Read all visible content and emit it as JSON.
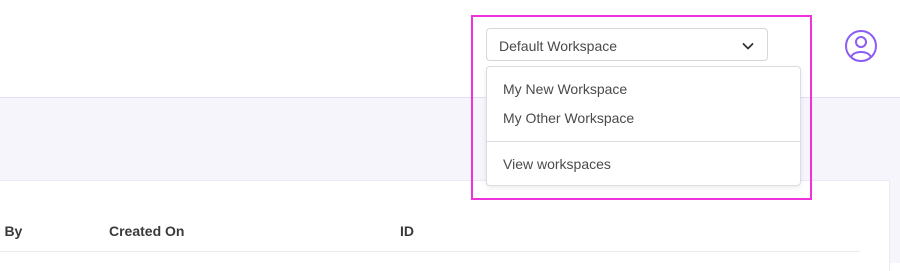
{
  "header": {
    "workspace_select": {
      "selected": "Default Workspace",
      "options": [
        "My New Workspace",
        "My Other Workspace"
      ],
      "footer_link": "View workspaces",
      "chevron_icon": "chevron-down-icon"
    },
    "avatar_icon": "user-circle-icon"
  },
  "table": {
    "columns": [
      "d By",
      "Created On",
      "ID"
    ]
  },
  "colors": {
    "accent": "#8b5cf6",
    "highlight": "#ee33dd",
    "band_background": "#f7f5fc"
  }
}
